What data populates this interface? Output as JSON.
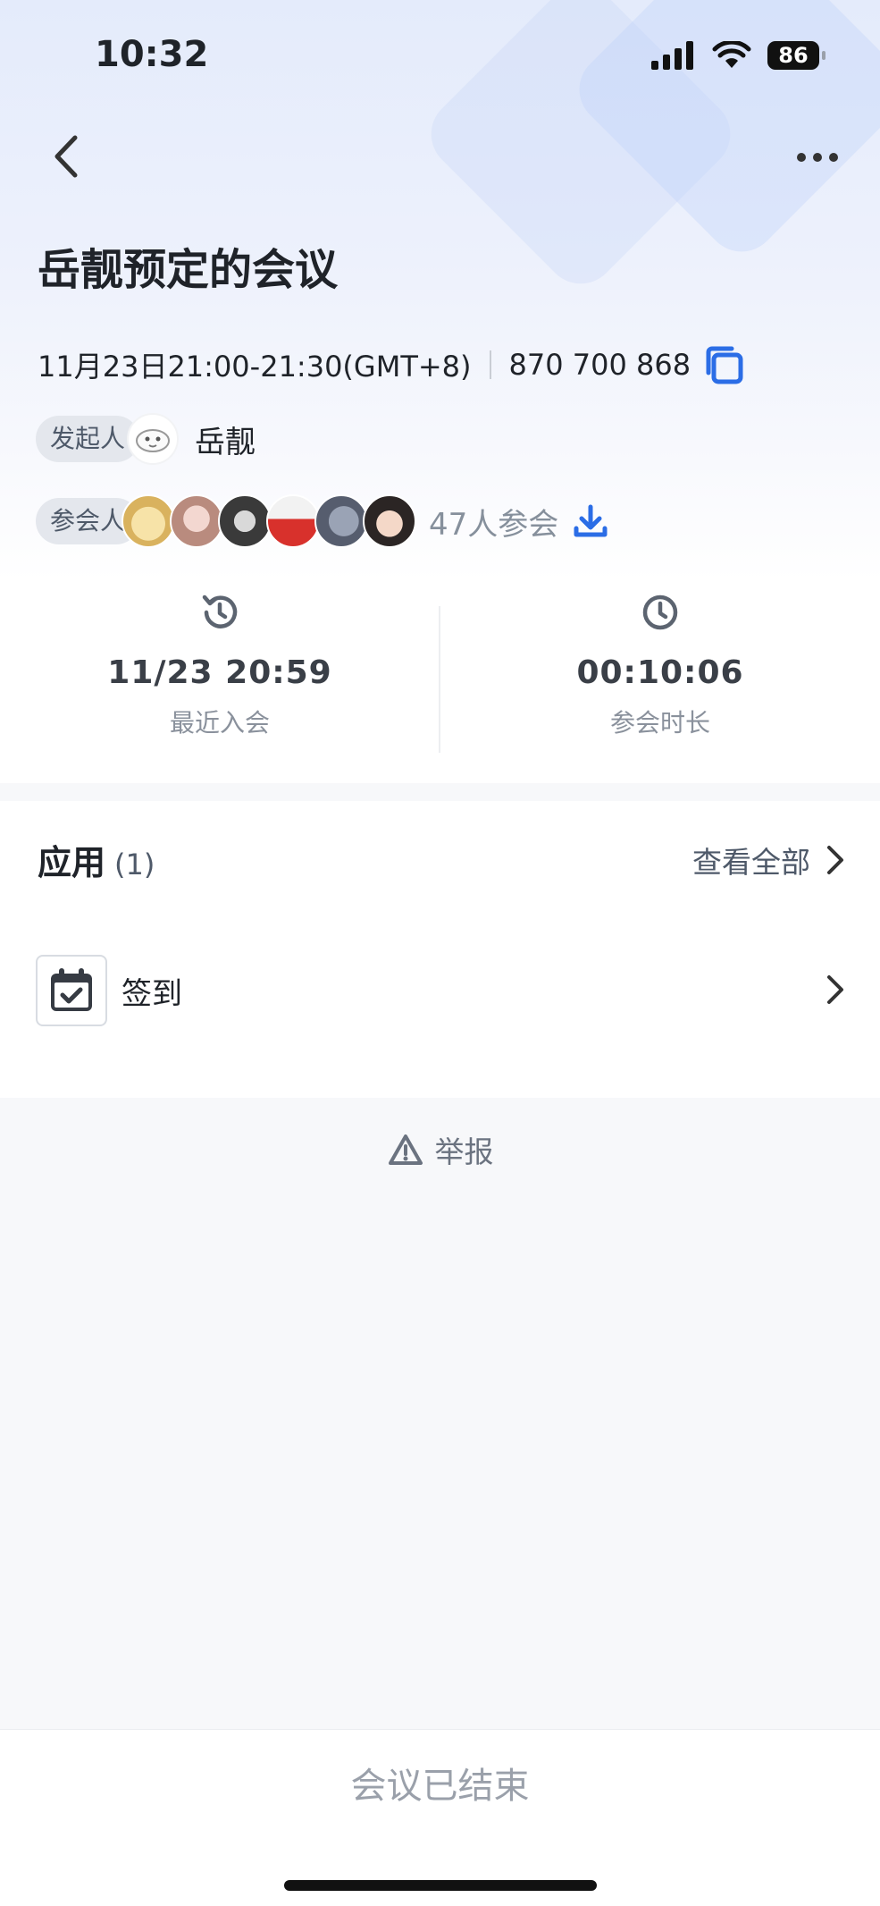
{
  "status_bar": {
    "time": "10:32",
    "battery": "86"
  },
  "header": {
    "title": "岳靓预定的会议"
  },
  "meeting": {
    "time_range": "11月23日21:00-21:30(GMT+8)",
    "meeting_id": "870 700 868"
  },
  "host": {
    "chip": "发起人",
    "name": "岳靓"
  },
  "participants": {
    "chip": "参会人",
    "count_text": "47人参会"
  },
  "stats": {
    "last_join": {
      "value": "11/23 20:59",
      "label": "最近入会"
    },
    "duration": {
      "value": "00:10:06",
      "label": "参会时长"
    }
  },
  "apps": {
    "title": "应用",
    "count": "(1)",
    "view_all": "查看全部",
    "items": [
      {
        "label": "签到",
        "icon": "calendar-check-icon"
      }
    ]
  },
  "report": {
    "label": "举报"
  },
  "footer": {
    "status": "会议已结束"
  },
  "colors": {
    "accent": "#2b6de6",
    "text": "#1f2329",
    "muted": "#86909c"
  }
}
